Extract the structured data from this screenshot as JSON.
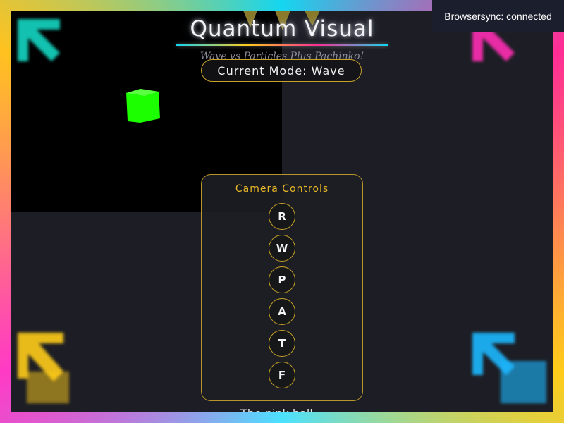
{
  "app": {
    "title": "Quantum Visual",
    "subtitle": "Wave vs Particles Plus Pachinko!",
    "mode_label": "Current Mode: Wave"
  },
  "camera_controls": {
    "title": "Camera Controls",
    "buttons": [
      "R",
      "W",
      "P",
      "A",
      "T",
      "F"
    ]
  },
  "footer_text": "The pink ball...",
  "browsersync": {
    "status": "Browsersync: connected"
  },
  "colors": {
    "accent_gold": "#c9a227",
    "cube_green": "#1cff00",
    "corner_cyan": "#14d6c2",
    "corner_pink": "#ff2db4",
    "corner_yellow": "#ffcc1a",
    "corner_blue": "#1cb8ff"
  },
  "icons": [
    "arrow-up-left-icon",
    "cube-icon"
  ]
}
